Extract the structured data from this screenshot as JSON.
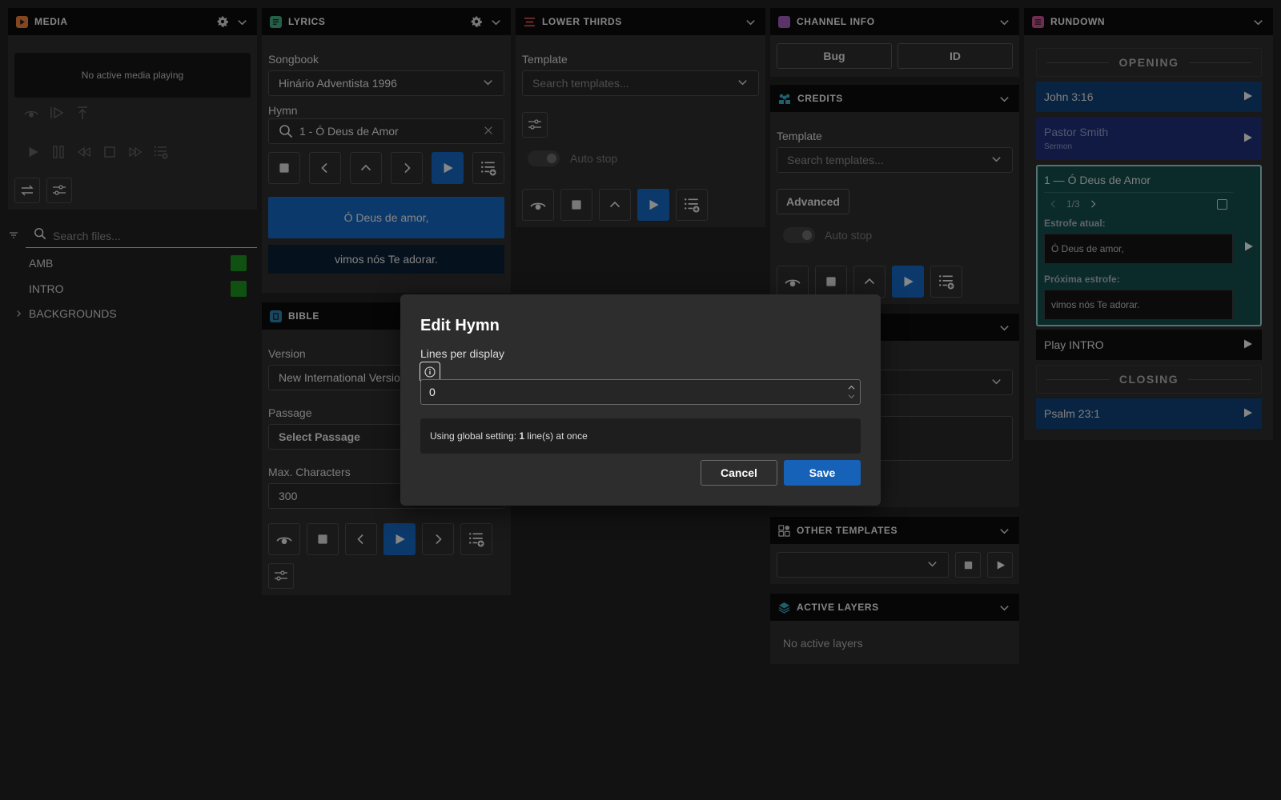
{
  "media": {
    "title": "MEDIA",
    "status": "No active media playing",
    "search_placeholder": "Search files...",
    "files": [
      {
        "name": "AMB",
        "color": "#1c8a1c"
      },
      {
        "name": "INTRO",
        "color": "#1c8a1c"
      }
    ],
    "folder": "BACKGROUNDS"
  },
  "lyrics": {
    "title": "LYRICS",
    "songbook_label": "Songbook",
    "songbook_value": "Hinário Adventista 1996",
    "hymn_label": "Hymn",
    "hymn_value": "1 - Ó Deus de Amor",
    "current_line": "Ó Deus de amor,",
    "next_line": "vimos nós Te adorar."
  },
  "bible": {
    "title": "BIBLE",
    "version_label": "Version",
    "version_value": "New International Version",
    "passage_label": "Passage",
    "passage_value": "Select Passage",
    "maxchars_label": "Max. Characters",
    "maxchars_value": "300"
  },
  "lower_thirds": {
    "title": "LOWER THIRDS",
    "template_label": "Template",
    "template_placeholder": "Search templates...",
    "autostop_label": "Auto stop"
  },
  "channel_info": {
    "title": "CHANNEL INFO",
    "bug_label": "Bug",
    "id_label": "ID"
  },
  "credits": {
    "title": "CREDITS",
    "template_label": "Template",
    "template_placeholder": "Search templates...",
    "advanced_label": "Advanced",
    "autostop_label": "Auto stop"
  },
  "other_templates": {
    "title": "OTHER TEMPLATES"
  },
  "active_layers": {
    "title": "ACTIVE LAYERS",
    "empty": "No active layers"
  },
  "rundown": {
    "title": "RUNDOWN",
    "sections": {
      "opening": "OPENING",
      "closing": "CLOSING"
    },
    "items": {
      "john": {
        "title": "John 3:16",
        "color": "#0e3f72"
      },
      "pastor": {
        "title": "Pastor Smith",
        "subtitle": "Sermon",
        "color": "#1e2e73"
      },
      "hymn": {
        "title": "1 — Ó Deus de Amor",
        "pager": "1/3",
        "current_label": "Estrofe atual:",
        "current_text": "Ó Deus de amor,",
        "next_label": "Próxima estrofe:",
        "next_text": "vimos nós Te adorar.",
        "color": "#124a49"
      },
      "play_intro": {
        "title": "Play INTRO"
      },
      "psalm": {
        "title": "Psalm 23:1",
        "color": "#0e3f72"
      }
    }
  },
  "modal": {
    "title": "Edit Hymn",
    "lines_label": "Lines per display",
    "lines_value": "0",
    "note_prefix": "Using global setting: ",
    "note_count": "1",
    "note_suffix": " line(s) at once",
    "cancel_label": "Cancel",
    "save_label": "Save"
  },
  "colors": {
    "play_blue": "#1562b8",
    "media_orange": "#e07b39",
    "lyrics_green": "#3fa57a",
    "lower_red": "#d9534f",
    "channel_purple": "#9b59b6",
    "credits_teal": "#3aa3b8",
    "rundown_pink": "#c0508a"
  }
}
